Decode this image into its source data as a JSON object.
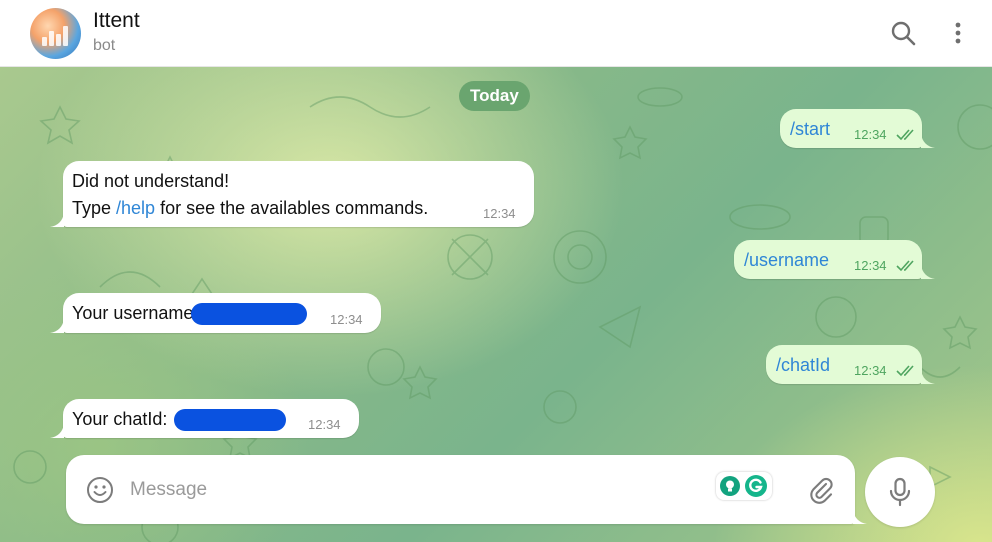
{
  "header": {
    "title": "Ittent",
    "subtitle": "bot",
    "icons": [
      "search-icon",
      "more-vertical-icon"
    ]
  },
  "chat": {
    "date_label": "Today",
    "messages": [
      {
        "direction": "out",
        "text": "/start",
        "time": "12:34",
        "status": "read"
      },
      {
        "direction": "in",
        "line1": "Did not understand!",
        "line2_prefix": "Type ",
        "line2_command": "/help",
        "line2_suffix": " for see the availables commands.",
        "time": "12:34"
      },
      {
        "direction": "out",
        "text": "/username",
        "time": "12:34",
        "status": "read"
      },
      {
        "direction": "in",
        "text": "Your username",
        "redacted": true,
        "time": "12:34"
      },
      {
        "direction": "out",
        "text": "/chatId",
        "time": "12:34",
        "status": "read"
      },
      {
        "direction": "in",
        "text": "Your chatId: ",
        "redacted": true,
        "time": "12:34"
      }
    ]
  },
  "composer": {
    "placeholder": "Message",
    "icons": [
      "emoji-icon",
      "grammarly-icon",
      "attach-icon",
      "microphone-icon"
    ]
  },
  "colors": {
    "outgoing_bubble": "#e3fbd6",
    "incoming_bubble": "#ffffff",
    "link": "#2f86d6",
    "date_pill": "#6aa56f",
    "redaction": "#0a52e0"
  }
}
